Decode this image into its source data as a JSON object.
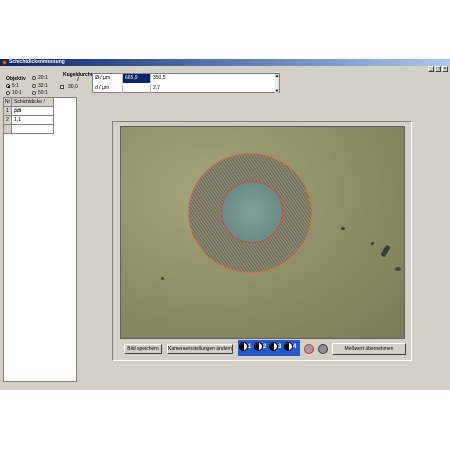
{
  "window": {
    "title": "Schichtdickenmessung",
    "controls": {
      "minimize": "_",
      "restore": "□",
      "close": "×"
    }
  },
  "objektiv": {
    "label": "Objektiv",
    "options": [
      {
        "label": "20:1",
        "selected": false
      },
      {
        "label": "5:1",
        "selected": true
      },
      {
        "label": "32:1",
        "selected": false
      },
      {
        "label": "10:1",
        "selected": false
      },
      {
        "label": "50:1",
        "selected": false
      }
    ]
  },
  "kugel": {
    "label": "Kugeldurchmesser /",
    "value": "30,0"
  },
  "measure_table": {
    "rows": [
      {
        "label": "Ø / µm",
        "col1": "665,9",
        "col2": "350,5"
      },
      {
        "label": "d / µm",
        "col1": "",
        "col2": "2,7"
      }
    ]
  },
  "results": {
    "header": "Schichtdicke / µm",
    "col_no": "Nr",
    "rows": [
      {
        "nr": "1",
        "value": "3,3"
      },
      {
        "nr": "2",
        "value": "1,1"
      }
    ]
  },
  "buttons": {
    "save_image": "Bild speichern",
    "camera_settings": "Kameraeinstellungen ändern",
    "take_measurement": "Meßwert übernehmen"
  },
  "tabs": [
    "1",
    "2",
    "3",
    "4"
  ],
  "colors": {
    "titlebar_start": "#0a246a",
    "selection": "#0a246a",
    "outer_ring": "#d46a50",
    "inner_ring": "#d04848",
    "tab_strip": "#2458c8"
  }
}
